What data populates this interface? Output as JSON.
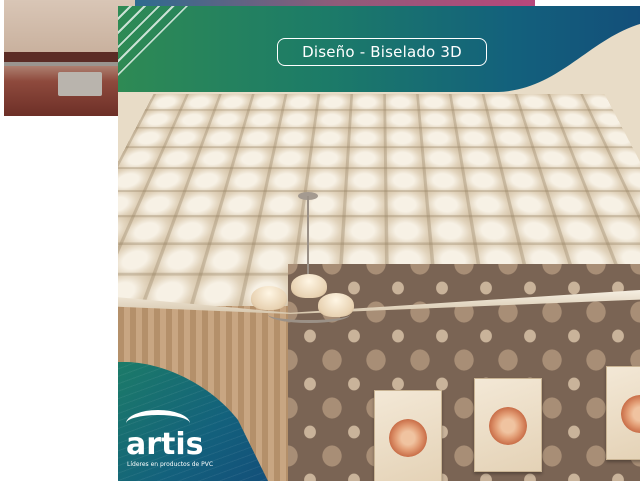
{
  "badge": {
    "title": "Diseño - Biselado 3D"
  },
  "logo": {
    "name": "artis",
    "tagline": "Líderes en productos de PVC"
  },
  "colors": {
    "band_start": "#2e8a54",
    "band_end": "#134f7a",
    "text": "#ffffff"
  },
  "icons": {
    "brand_mark": "whale-wave-icon"
  }
}
